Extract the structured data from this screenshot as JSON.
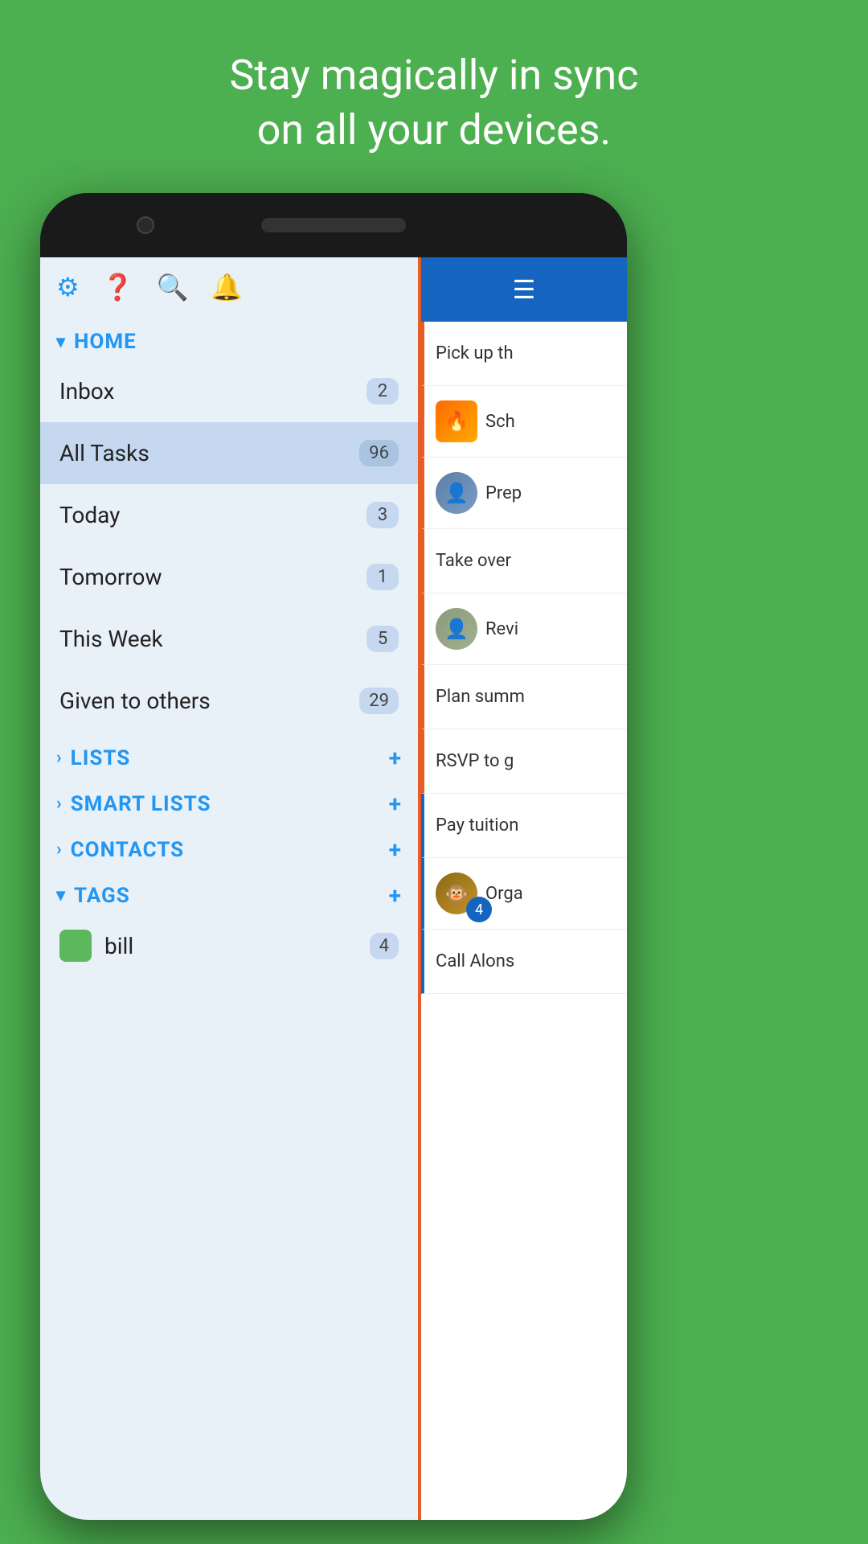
{
  "header": {
    "line1": "Stay magically in sync",
    "line2": "on all your devices."
  },
  "toolbar": {
    "icons": [
      "gear-icon",
      "help-icon",
      "search-icon",
      "bell-icon"
    ]
  },
  "drawer": {
    "home_section": {
      "label": "HOME",
      "expanded": true
    },
    "nav_items": [
      {
        "label": "Inbox",
        "count": "2",
        "active": false
      },
      {
        "label": "All Tasks",
        "count": "96",
        "active": true
      },
      {
        "label": "Today",
        "count": "3",
        "active": false
      },
      {
        "label": "Tomorrow",
        "count": "1",
        "active": false
      },
      {
        "label": "This Week",
        "count": "5",
        "active": false
      },
      {
        "label": "Given to others",
        "count": "29",
        "active": false
      }
    ],
    "sections": [
      {
        "label": "LISTS",
        "has_plus": true,
        "expanded": false
      },
      {
        "label": "SMART LISTS",
        "has_plus": true,
        "expanded": false
      },
      {
        "label": "CONTACTS",
        "has_plus": true,
        "expanded": false
      },
      {
        "label": "TAGS",
        "has_plus": true,
        "expanded": true
      }
    ],
    "tags": [
      {
        "label": "bill",
        "count": "4",
        "color": "#5cb85c"
      }
    ]
  },
  "tasks": {
    "items": [
      {
        "text": "Pick up th",
        "avatar": null,
        "accent": "orange"
      },
      {
        "text": "Sch",
        "avatar": "fire",
        "accent": "orange"
      },
      {
        "text": "Prep",
        "avatar": "person1",
        "accent": "orange"
      },
      {
        "text": "Take over",
        "avatar": null,
        "accent": "orange"
      },
      {
        "text": "Revi",
        "avatar": "person2",
        "accent": "orange"
      },
      {
        "text": "Plan summ",
        "avatar": null,
        "accent": "orange"
      },
      {
        "text": "RSVP to g",
        "avatar": null,
        "accent": "orange"
      },
      {
        "text": "Pay tuition",
        "avatar": null,
        "accent": "blue"
      },
      {
        "text": "Orga",
        "avatar": "monkey",
        "badge": "4",
        "accent": "blue"
      },
      {
        "text": "Call Alons",
        "avatar": null,
        "accent": "blue"
      }
    ]
  },
  "hamburger_label": "≡"
}
